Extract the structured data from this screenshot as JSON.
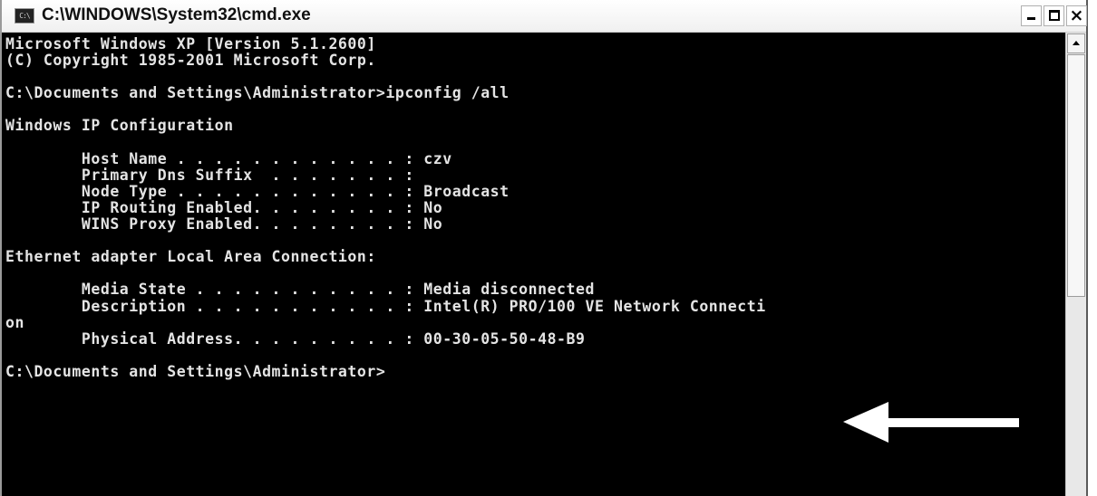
{
  "window": {
    "title": "C:\\WINDOWS\\System32\\cmd.exe",
    "icon": "console-icon",
    "icon_text": "C:\\"
  },
  "controls": {
    "minimize_icon": "minimize-icon",
    "maximize_icon": "maximize-icon",
    "close_icon": "close-icon",
    "close_glyph": "×"
  },
  "console": {
    "lines": [
      "Microsoft Windows XP [Version 5.1.2600]",
      "(C) Copyright 1985-2001 Microsoft Corp.",
      "",
      "C:\\Documents and Settings\\Administrator>ipconfig /all",
      "",
      "Windows IP Configuration",
      "",
      "        Host Name . . . . . . . . . . . . : czv",
      "        Primary Dns Suffix  . . . . . . . :",
      "        Node Type . . . . . . . . . . . . : Broadcast",
      "        IP Routing Enabled. . . . . . . . : No",
      "        WINS Proxy Enabled. . . . . . . . : No",
      "",
      "Ethernet adapter Local Area Connection:",
      "",
      "        Media State . . . . . . . . . . . : Media disconnected",
      "        Description . . . . . . . . . . . : Intel(R) PRO/100 VE Network Connecti",
      "on",
      "        Physical Address. . . . . . . . . : 00-30-05-50-48-B9",
      "",
      "C:\\Documents and Settings\\Administrator>"
    ],
    "text_color": "#e4e4e4",
    "background": "#000000"
  },
  "annotation": {
    "icon": "left-arrow-icon",
    "color": "#ffffff"
  }
}
